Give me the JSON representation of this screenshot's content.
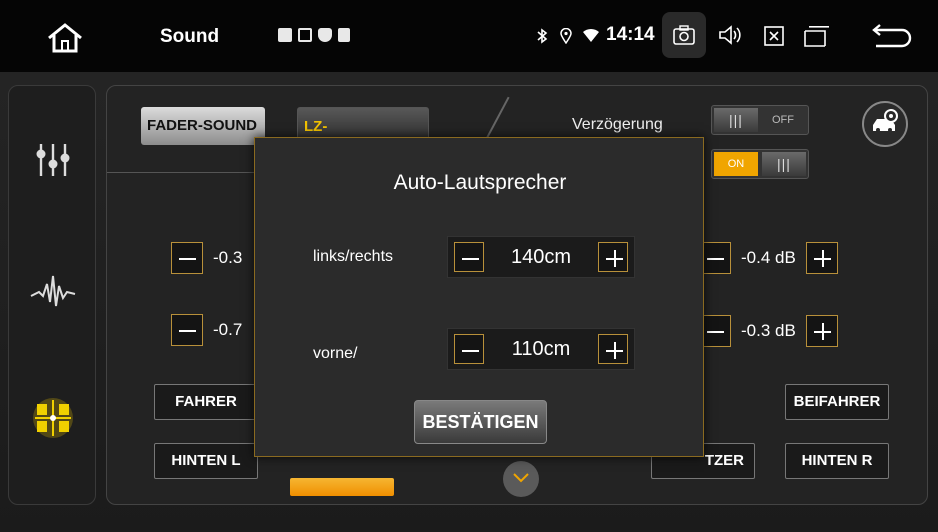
{
  "statusbar": {
    "title": "Sound",
    "time": "14:14",
    "icons": [
      "home-icon",
      "image-icon",
      "mail-icon",
      "shield-icon",
      "sdcard-icon",
      "bluetooth-icon",
      "location-icon",
      "wifi-icon",
      "camera-icon",
      "volume-icon",
      "close-box-icon",
      "window-icon",
      "back-icon"
    ]
  },
  "sidebar": {
    "items": [
      {
        "icon": "equalizer-sliders-icon"
      },
      {
        "icon": "waveform-icon"
      },
      {
        "icon": "speaker-balance-icon",
        "active": true
      }
    ]
  },
  "tabs": {
    "fader_sound": "FADER-SOUND",
    "lz_korrektur": "LZ-KORREKTUR"
  },
  "delay": {
    "label": "Verzögerung",
    "toggle1_label": "OFF",
    "toggle2_label": "ON",
    "knob": "|||"
  },
  "left_steppers": [
    {
      "value": "-0.3"
    },
    {
      "value": "-0.7"
    }
  ],
  "right_steppers": [
    {
      "value": "-0.4 dB"
    },
    {
      "value": "-0.3 dB"
    }
  ],
  "seats": {
    "fahrer": "FAHRER",
    "hinten_l": "HINTEN L",
    "beifahrer": "BEIFAHRER",
    "hinten_r": "HINTEN R",
    "partial": "TZER"
  },
  "dialog": {
    "title": "Auto-Lautsprecher",
    "row1_label": "links/rechts",
    "row1_value": "140cm",
    "row2_label": "vorne/",
    "row2_value": "110cm",
    "confirm": "BESTÄTIGEN"
  },
  "colors": {
    "accent": "#f0a500",
    "border_gold": "#b8903a"
  }
}
